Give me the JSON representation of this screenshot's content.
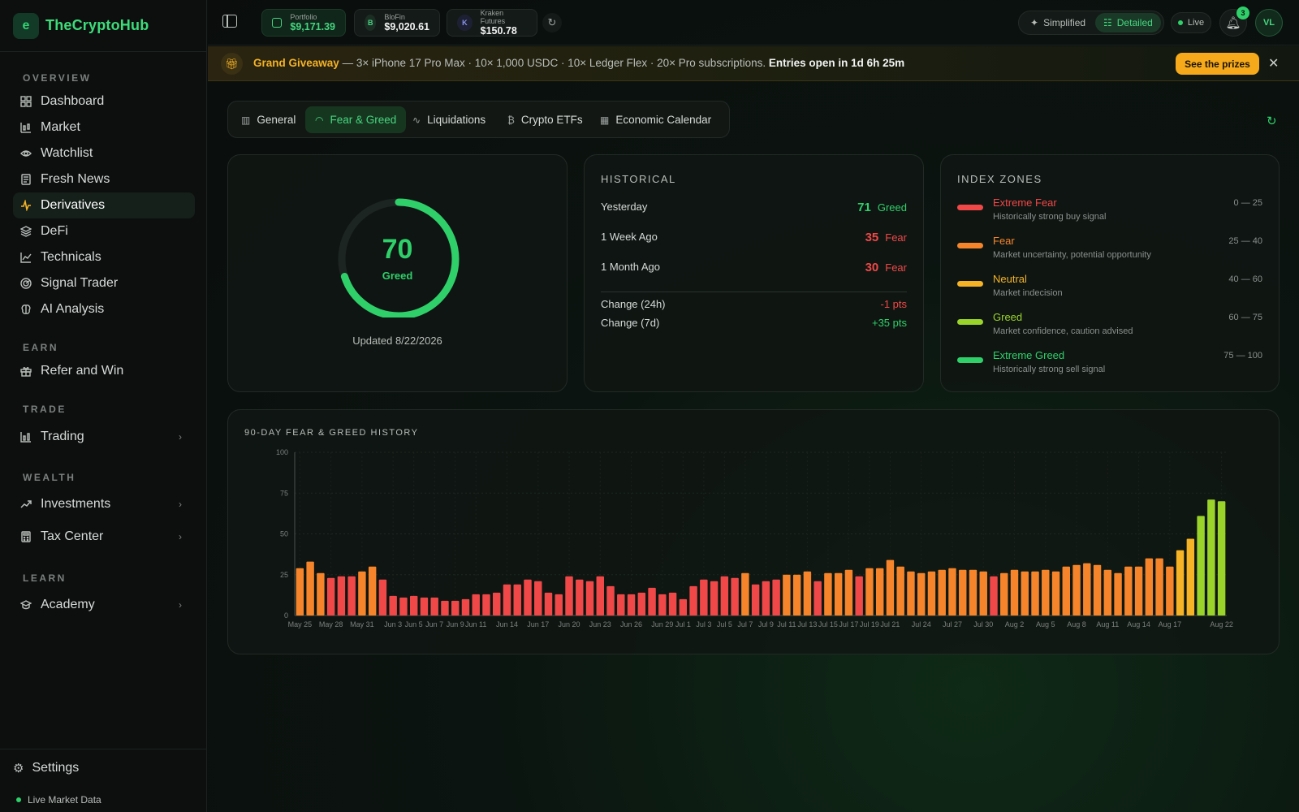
{
  "brand": {
    "name": "TheCryptoHub",
    "logo": "e"
  },
  "sidebar": {
    "sections": {
      "overview": "OVERVIEW",
      "earn": "EARN",
      "trade": "TRADE",
      "wealth": "WEALTH",
      "learn": "LEARN"
    },
    "items": [
      {
        "label": "Dashboard",
        "icon": "grid-icon"
      },
      {
        "label": "Market",
        "icon": "candles-icon"
      },
      {
        "label": "Watchlist",
        "icon": "eye-icon"
      },
      {
        "label": "Fresh News",
        "icon": "newspaper-icon"
      },
      {
        "label": "Derivatives",
        "icon": "pulse-icon",
        "active": true
      },
      {
        "label": "DeFi",
        "icon": "layers-icon"
      },
      {
        "label": "Technicals",
        "icon": "line-chart-icon"
      },
      {
        "label": "Signal Trader",
        "icon": "radar-icon"
      },
      {
        "label": "AI Analysis",
        "icon": "brain-icon"
      },
      {
        "label": "Refer and Win",
        "icon": "gift-icon"
      },
      {
        "label": "Trading",
        "icon": "bar-chart-icon"
      },
      {
        "label": "Investments",
        "icon": "trending-up-icon"
      },
      {
        "label": "Tax Center",
        "icon": "calculator-icon"
      },
      {
        "label": "Academy",
        "icon": "graduation-cap-icon"
      }
    ],
    "settings": "Settings",
    "live_market": "Live Market Data"
  },
  "topbar": {
    "accounts": [
      {
        "label": "Portfolio",
        "value": "$9,171.39"
      },
      {
        "label": "BloFin",
        "value": "$9,020.61",
        "badge": "B"
      },
      {
        "label": "Kraken Futures",
        "value": "$150.78",
        "badge": "K"
      }
    ],
    "modes": {
      "simplified": "Simplified",
      "detailed": "Detailed",
      "active": "detailed"
    },
    "live": "Live",
    "notifications": "3",
    "avatar": "VL"
  },
  "promo": {
    "title": "Grand Giveaway",
    "body": " — 3× iPhone 17 Pro Max · 10× 1,000 USDC · 10× Ledger Flex · 20× Pro subscriptions. ",
    "countdown": "Entries open in 1d 6h 25m",
    "cta": "See the prizes"
  },
  "tabs": [
    {
      "label": "General",
      "icon": "bar-chart-icon"
    },
    {
      "label": "Fear & Greed",
      "icon": "gauge-icon",
      "active": true
    },
    {
      "label": "Liquidations",
      "icon": "pulse-icon"
    },
    {
      "label": "Crypto ETFs",
      "icon": "bitcoin-icon"
    },
    {
      "label": "Economic Calendar",
      "icon": "calendar-icon"
    }
  ],
  "gauge": {
    "value": 70,
    "value_text": "70",
    "label": "Greed",
    "updated": "Updated 8/22/2026",
    "color": "#2fd06a"
  },
  "historical": {
    "title": "HISTORICAL",
    "rows": [
      {
        "label": "Yesterday",
        "value": "71",
        "sentiment": "Greed",
        "color": "green"
      },
      {
        "label": "1 Week Ago",
        "value": "35",
        "sentiment": "Fear",
        "color": "red"
      },
      {
        "label": "1 Month Ago",
        "value": "30",
        "sentiment": "Fear",
        "color": "red"
      }
    ],
    "changes": [
      {
        "label": "Change (24h)",
        "value": "-1 pts",
        "color": "red"
      },
      {
        "label": "Change (7d)",
        "value": "+35 pts",
        "color": "green"
      }
    ]
  },
  "zones": {
    "title": "INDEX ZONES",
    "items": [
      {
        "name": "Extreme Fear",
        "desc": "Historically strong buy signal",
        "range": "0 — 25",
        "color": "#f04848"
      },
      {
        "name": "Fear",
        "desc": "Market uncertainty, potential opportunity",
        "range": "25 — 40",
        "color": "#f5842a"
      },
      {
        "name": "Neutral",
        "desc": "Market indecision",
        "range": "40 — 60",
        "color": "#f5b325"
      },
      {
        "name": "Greed",
        "desc": "Market confidence, caution advised",
        "range": "60 — 75",
        "color": "#9ad32a"
      },
      {
        "name": "Extreme Greed",
        "desc": "Historically strong sell signal",
        "range": "75 — 100",
        "color": "#2fd06a"
      }
    ]
  },
  "chart_data": {
    "type": "bar",
    "title": "90-DAY FEAR & GREED HISTORY",
    "ylim": [
      0,
      100
    ],
    "yticks": [
      0,
      25,
      50,
      75,
      100
    ],
    "xtick_labels": [
      "May 25",
      "May 28",
      "May 31",
      "Jun 3",
      "Jun 5",
      "Jun 7",
      "Jun 9",
      "Jun 11",
      "Jun 14",
      "Jun 17",
      "Jun 20",
      "Jun 23",
      "Jun 26",
      "Jun 29",
      "Jul 1",
      "Jul 3",
      "Jul 5",
      "Jul 7",
      "Jul 9",
      "Jul 11",
      "Jul 13",
      "Jul 15",
      "Jul 17",
      "Jul 19",
      "Jul 21",
      "Jul 24",
      "Jul 27",
      "Jul 30",
      "Aug 2",
      "Aug 5",
      "Aug 8",
      "Aug 11",
      "Aug 14",
      "Aug 17",
      "Aug 22"
    ],
    "xtick_index": [
      0,
      3,
      6,
      9,
      11,
      13,
      15,
      17,
      20,
      23,
      26,
      29,
      32,
      35,
      37,
      39,
      41,
      43,
      45,
      47,
      49,
      51,
      53,
      55,
      57,
      60,
      63,
      66,
      69,
      72,
      75,
      78,
      81,
      84,
      89
    ],
    "values": [
      29,
      33,
      26,
      23,
      24,
      24,
      27,
      30,
      22,
      12,
      11,
      12,
      11,
      11,
      9,
      9,
      10,
      13,
      13,
      14,
      19,
      19,
      22,
      21,
      14,
      13,
      24,
      22,
      21,
      24,
      18,
      13,
      13,
      14,
      17,
      13,
      14,
      10,
      18,
      22,
      21,
      24,
      23,
      26,
      19,
      21,
      22,
      25,
      25,
      27,
      21,
      26,
      26,
      28,
      24,
      29,
      29,
      34,
      30,
      27,
      26,
      27,
      28,
      29,
      28,
      28,
      27,
      24,
      26,
      28,
      27,
      27,
      28,
      27,
      30,
      31,
      32,
      31,
      28,
      26,
      30,
      30,
      35,
      35,
      30,
      40,
      47,
      61,
      71,
      70
    ],
    "zone_colors": {
      "extreme_fear": "#f04848",
      "fear": "#f5842a",
      "neutral": "#f5b325",
      "greed": "#9ad32a",
      "extreme_greed": "#2fd06a"
    }
  }
}
